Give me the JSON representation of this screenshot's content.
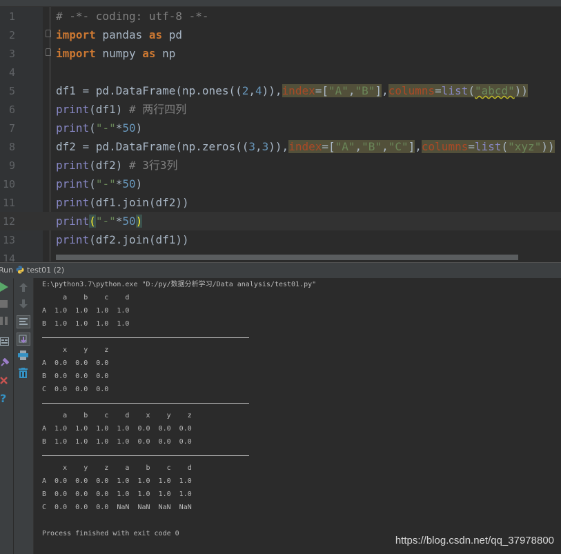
{
  "editor": {
    "lines": [
      {
        "n": "1",
        "tokens": [
          {
            "t": "# -*- coding: utf-8 -*-",
            "c": "cm"
          }
        ]
      },
      {
        "n": "2",
        "fold": true,
        "tokens": [
          {
            "t": "import",
            "c": "kw"
          },
          {
            "t": " pandas "
          },
          {
            "t": "as",
            "c": "kw"
          },
          {
            "t": " pd"
          }
        ]
      },
      {
        "n": "3",
        "fold": true,
        "tokens": [
          {
            "t": "import",
            "c": "kw"
          },
          {
            "t": " numpy "
          },
          {
            "t": "as",
            "c": "kw"
          },
          {
            "t": " np"
          }
        ]
      },
      {
        "n": "4",
        "tokens": []
      },
      {
        "n": "5",
        "tokens": [
          {
            "t": "df1 = pd.DataFrame(np.ones(("
          },
          {
            "t": "2",
            "c": "num"
          },
          {
            "t": ","
          },
          {
            "t": "4",
            "c": "num"
          },
          {
            "t": ")),"
          },
          {
            "t": "index",
            "c": "kwa hl"
          },
          {
            "t": "=[",
            "c": "hl"
          },
          {
            "t": "\"A\"",
            "c": "str hl"
          },
          {
            "t": ",",
            "c": "hl"
          },
          {
            "t": "\"B\"",
            "c": "str hl"
          },
          {
            "t": "]",
            "c": "hl"
          },
          {
            "t": ","
          },
          {
            "t": "columns",
            "c": "kwa hl"
          },
          {
            "t": "=",
            "c": "hl"
          },
          {
            "t": "list",
            "c": "bi hl"
          },
          {
            "t": "(",
            "c": "hl"
          },
          {
            "t": "\"abcd\"",
            "c": "str hl wavy"
          },
          {
            "t": "))",
            "c": "hl"
          }
        ]
      },
      {
        "n": "6",
        "tokens": [
          {
            "t": "print",
            "c": "bi"
          },
          {
            "t": "(df1) "
          },
          {
            "t": "# 两行四列",
            "c": "cm"
          }
        ]
      },
      {
        "n": "7",
        "tokens": [
          {
            "t": "print",
            "c": "bi"
          },
          {
            "t": "("
          },
          {
            "t": "\"-\"",
            "c": "str"
          },
          {
            "t": "*"
          },
          {
            "t": "50",
            "c": "num"
          },
          {
            "t": ")"
          }
        ]
      },
      {
        "n": "8",
        "tokens": [
          {
            "t": "df2 = pd.DataFrame(np.zeros(("
          },
          {
            "t": "3",
            "c": "num"
          },
          {
            "t": ","
          },
          {
            "t": "3",
            "c": "num"
          },
          {
            "t": ")),"
          },
          {
            "t": "index",
            "c": "kwa hl"
          },
          {
            "t": "=[",
            "c": "hl"
          },
          {
            "t": "\"A\"",
            "c": "str hl"
          },
          {
            "t": ",",
            "c": "hl"
          },
          {
            "t": "\"B\"",
            "c": "str hl"
          },
          {
            "t": ",",
            "c": "hl"
          },
          {
            "t": "\"C\"",
            "c": "str hl"
          },
          {
            "t": "]",
            "c": "hl"
          },
          {
            "t": ","
          },
          {
            "t": "columns",
            "c": "kwa hl"
          },
          {
            "t": "=",
            "c": "hl"
          },
          {
            "t": "list",
            "c": "bi hl"
          },
          {
            "t": "(",
            "c": "hl"
          },
          {
            "t": "\"xyz\"",
            "c": "str hl"
          },
          {
            "t": "))",
            "c": "hl"
          }
        ]
      },
      {
        "n": "9",
        "tokens": [
          {
            "t": "print",
            "c": "bi"
          },
          {
            "t": "(df2) "
          },
          {
            "t": "# 3行3列",
            "c": "cm"
          }
        ]
      },
      {
        "n": "10",
        "tokens": [
          {
            "t": "print",
            "c": "bi"
          },
          {
            "t": "("
          },
          {
            "t": "\"-\"",
            "c": "str"
          },
          {
            "t": "*"
          },
          {
            "t": "50",
            "c": "num"
          },
          {
            "t": ")"
          }
        ]
      },
      {
        "n": "11",
        "tokens": [
          {
            "t": "print",
            "c": "bi"
          },
          {
            "t": "(df1.join(df2))"
          }
        ]
      },
      {
        "n": "12",
        "current": true,
        "tokens": [
          {
            "t": "print",
            "c": "bi"
          },
          {
            "t": "(",
            "c": "paren"
          },
          {
            "t": "\"-\"",
            "c": "str"
          },
          {
            "t": "*"
          },
          {
            "t": "50",
            "c": "num"
          },
          {
            "t": ")",
            "c": "paren"
          }
        ]
      },
      {
        "n": "13",
        "tokens": [
          {
            "t": "print",
            "c": "bi"
          },
          {
            "t": "(df2.join(df1))"
          }
        ]
      },
      {
        "n": "14",
        "tokens": []
      }
    ]
  },
  "run_panel": {
    "label": "Run",
    "tab_label": "test01 (2)"
  },
  "console": {
    "lines": [
      "E:\\python3.7\\python.exe \"D:/py/数据分析学习/Data analysis/test01.py\"",
      "     a    b    c    d",
      "A  1.0  1.0  1.0  1.0",
      "B  1.0  1.0  1.0  1.0",
      "---",
      "     x    y    z",
      "A  0.0  0.0  0.0",
      "B  0.0  0.0  0.0",
      "C  0.0  0.0  0.0",
      "---",
      "     a    b    c    d    x    y    z",
      "A  1.0  1.0  1.0  1.0  0.0  0.0  0.0",
      "B  1.0  1.0  1.0  1.0  0.0  0.0  0.0",
      "---",
      "     x    y    z    a    b    c    d",
      "A  0.0  0.0  0.0  1.0  1.0  1.0  1.0",
      "B  0.0  0.0  0.0  1.0  1.0  1.0  1.0",
      "C  0.0  0.0  0.0  NaN  NaN  NaN  NaN",
      "",
      "Process finished with exit code 0"
    ]
  },
  "watermark": "https://blog.csdn.net/qq_37978800",
  "toolbar_icons": {
    "left": [
      "run-icon",
      "stop-icon",
      "pause-icon",
      "layout-icon",
      "pin-icon",
      "close-icon",
      "help-icon"
    ],
    "right": [
      "up-arrow-icon",
      "down-arrow-icon",
      "soft-wrap-icon",
      "scroll-to-end-icon",
      "print-icon",
      "trash-icon"
    ]
  },
  "colors": {
    "background": "#2b2b2b",
    "keyword": "#cc7832",
    "string": "#6a8759",
    "number": "#6897bb",
    "builtin": "#8888c6",
    "comment": "#808080",
    "kwarg": "#aa4926",
    "run_green": "#59a869",
    "close_red": "#c75450",
    "help_blue": "#3592c4"
  }
}
